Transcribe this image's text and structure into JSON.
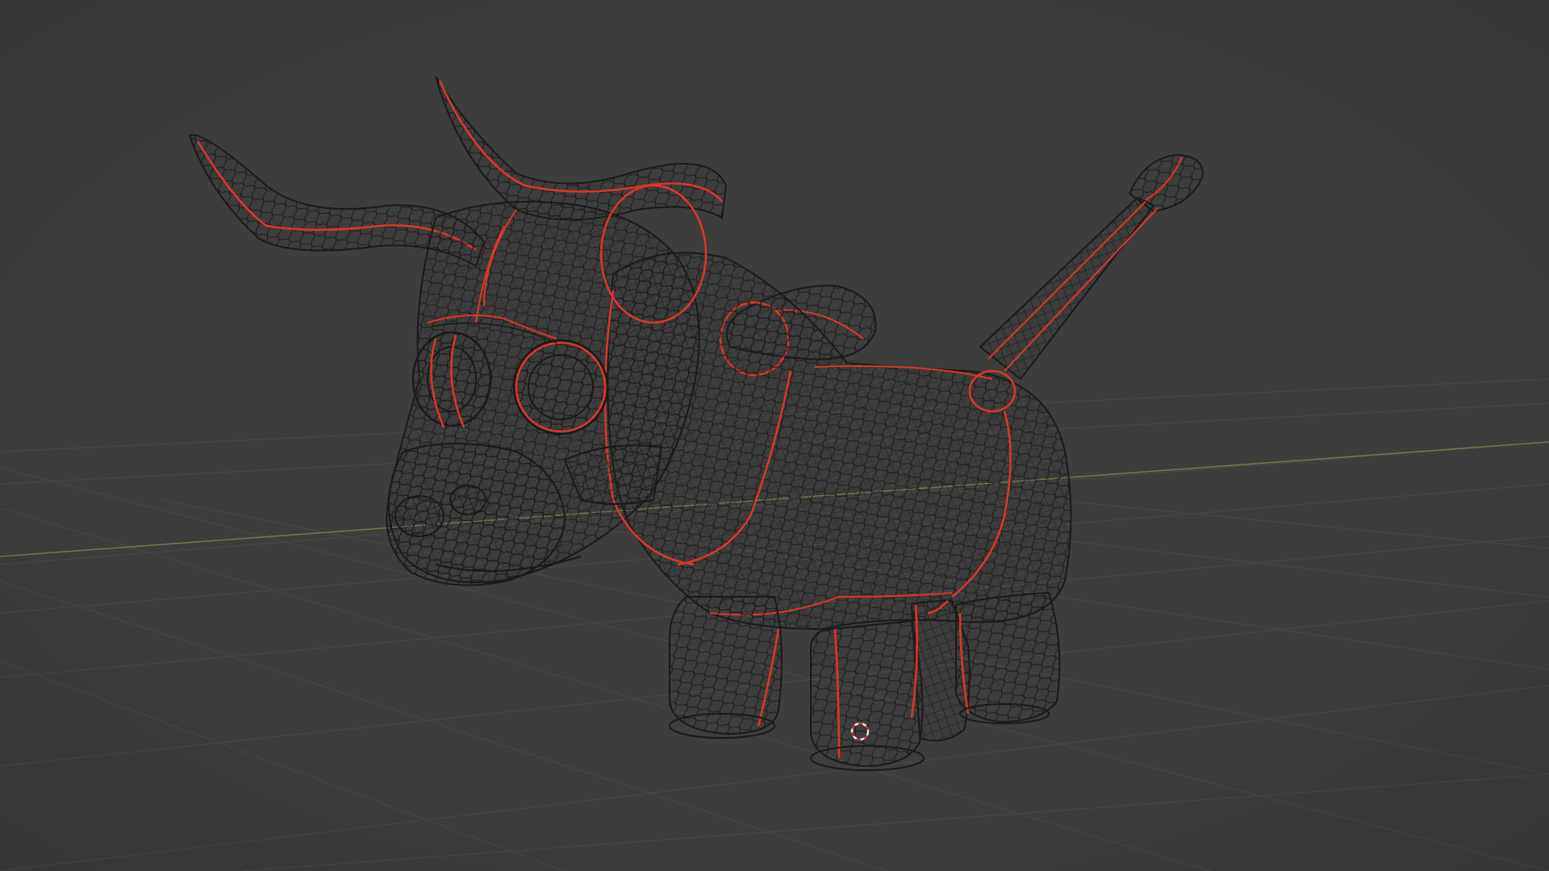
{
  "viewport": {
    "background_color": "#3d3d3d",
    "grid_color": "#484848",
    "x_axis_color": "#6d7a4f",
    "wire_color": "#1a1a1a",
    "seam_color": "#e0352a",
    "cursor_color_a": "#e8e8e8",
    "cursor_color_b": "#d0312d"
  },
  "scene": {
    "object_icon": "bull-wireframe-mesh",
    "cursor_icon": "3d-cursor-icon"
  }
}
